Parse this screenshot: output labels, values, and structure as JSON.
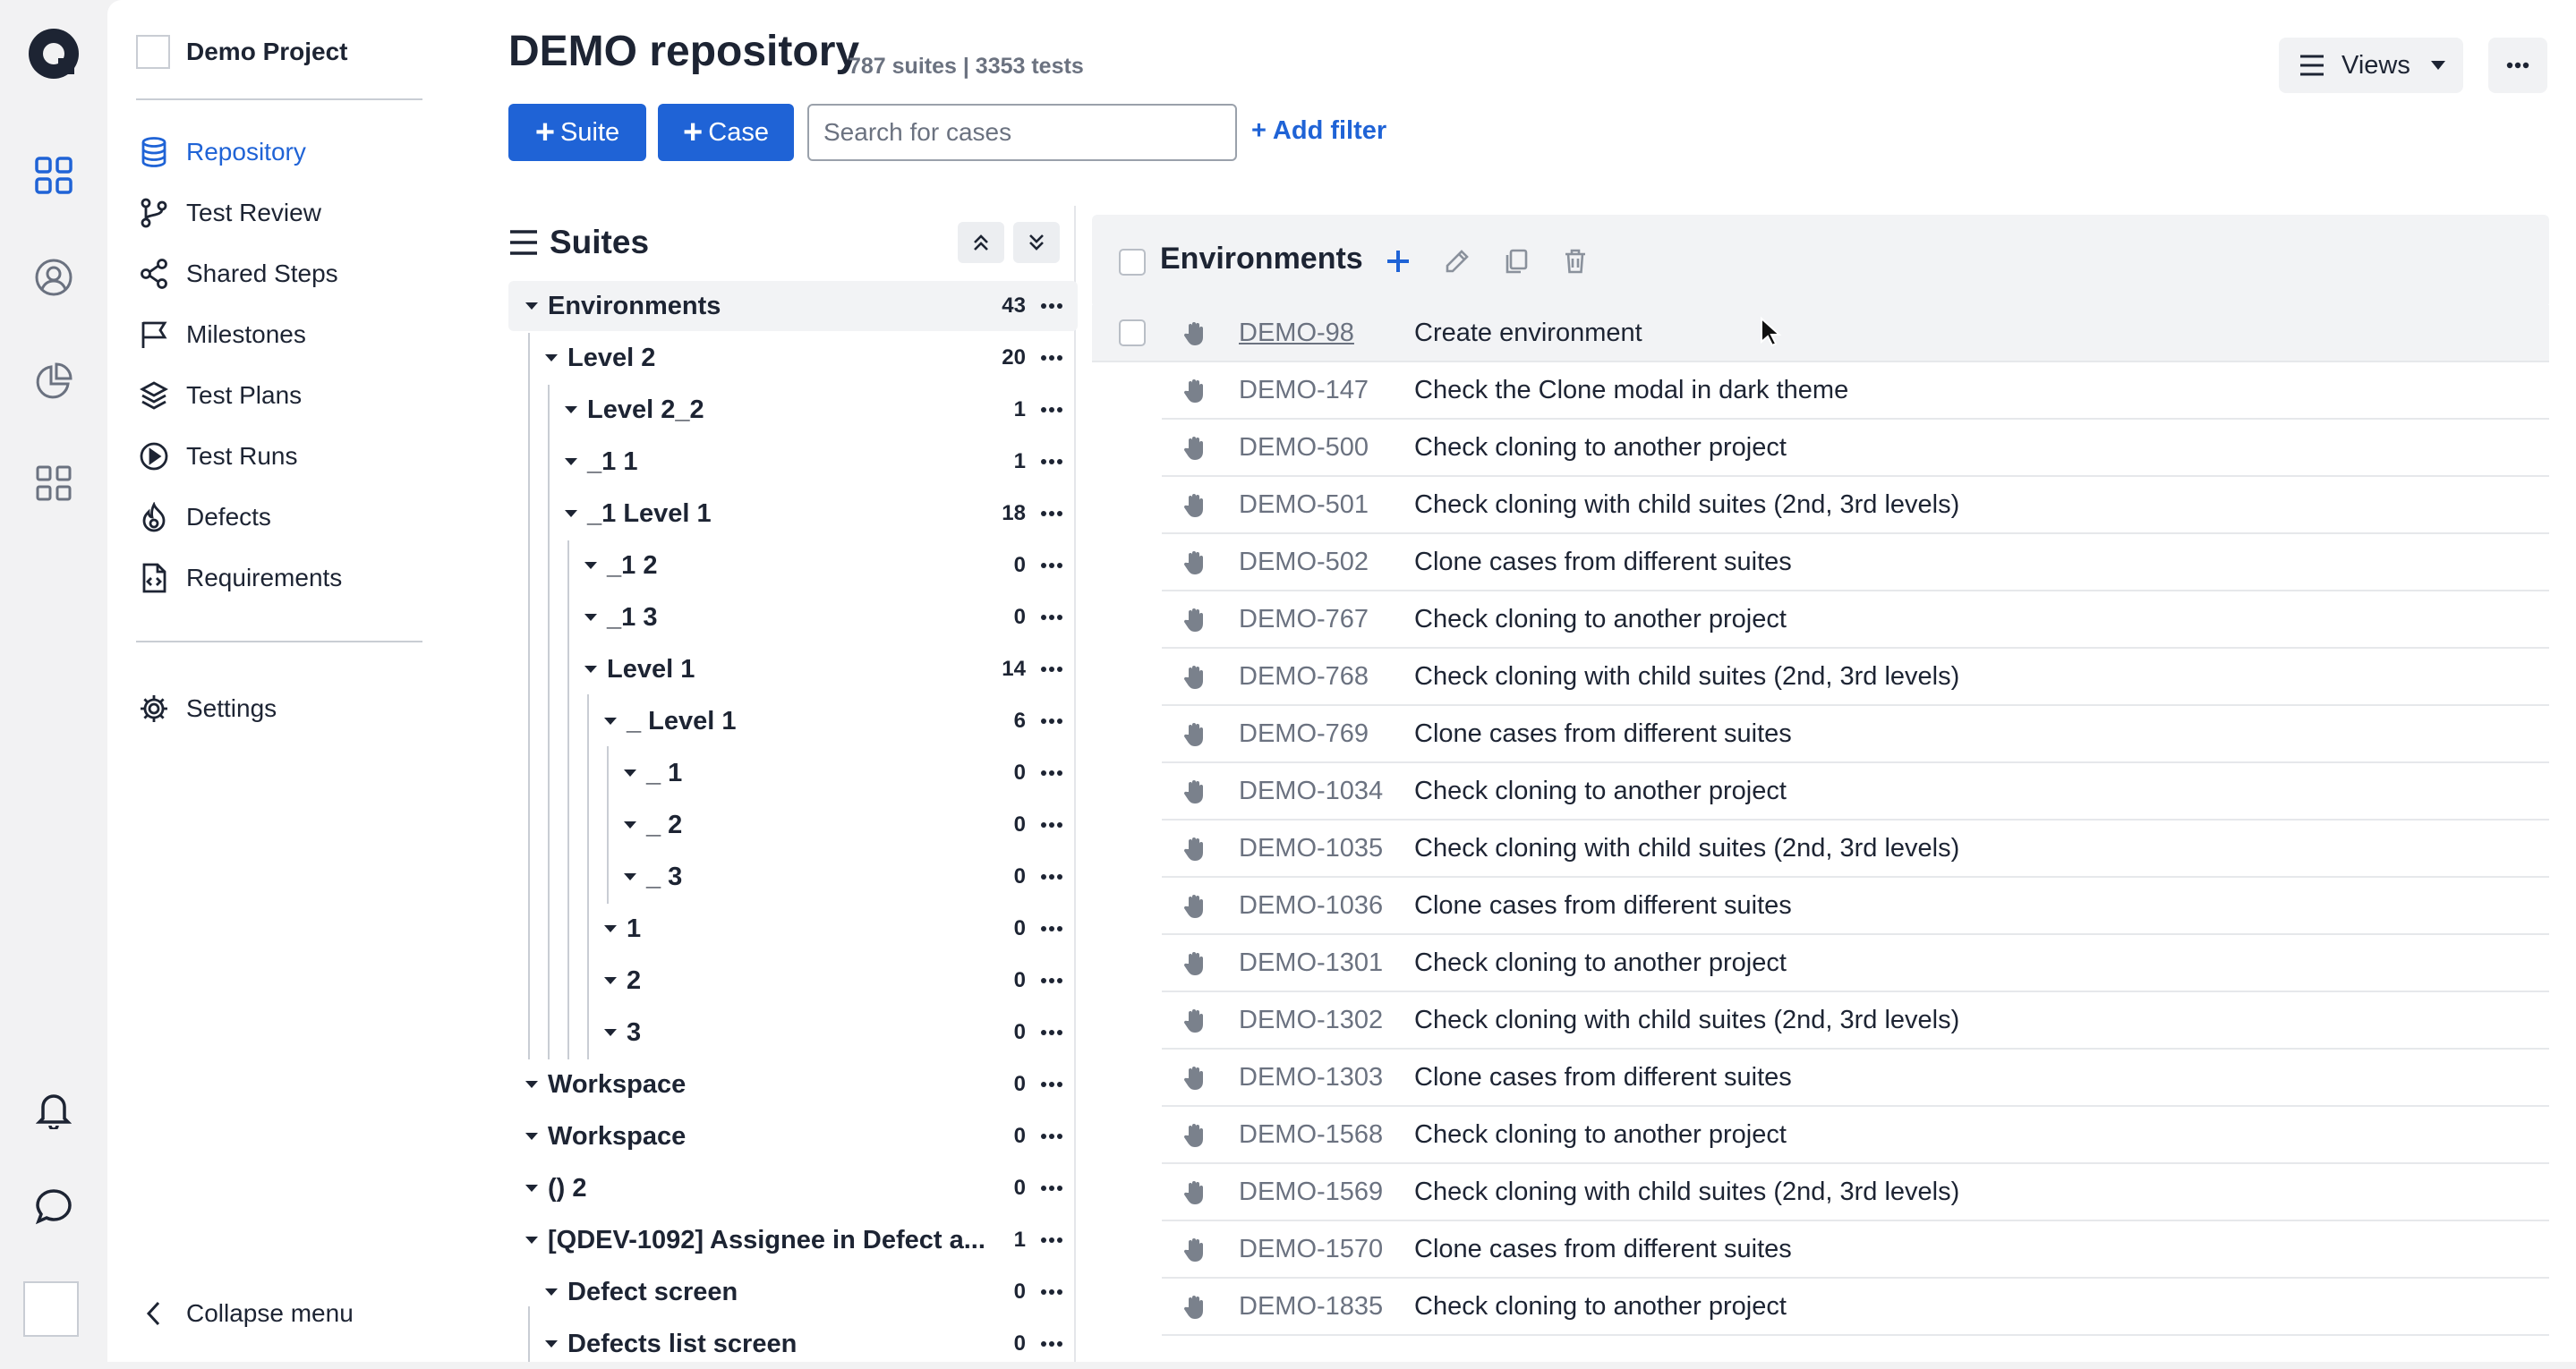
{
  "project": {
    "name": "Demo Project"
  },
  "nav": {
    "items": [
      {
        "label": "Repository",
        "icon": "database-icon",
        "active": true
      },
      {
        "label": "Test Review",
        "icon": "branch-icon"
      },
      {
        "label": "Shared Steps",
        "icon": "share-icon"
      },
      {
        "label": "Milestones",
        "icon": "flag-icon"
      },
      {
        "label": "Test Plans",
        "icon": "layers-icon"
      },
      {
        "label": "Test Runs",
        "icon": "play-circle-icon"
      },
      {
        "label": "Defects",
        "icon": "flame-icon"
      },
      {
        "label": "Requirements",
        "icon": "file-code-icon"
      }
    ],
    "settings": "Settings",
    "collapse": "Collapse menu"
  },
  "header": {
    "title": "DEMO repository",
    "counts": "787 suites | 3353 tests",
    "suite_btn": "Suite",
    "case_btn": "Case",
    "search_placeholder": "Search for cases",
    "add_filter": "+ Add filter",
    "views": "Views"
  },
  "suites": {
    "title": "Suites",
    "rows": [
      {
        "label": "Environments",
        "count": "43"
      },
      {
        "label": "Level 2",
        "count": "20"
      },
      {
        "label": "Level 2_2",
        "count": "1"
      },
      {
        "label": "_1 1",
        "count": "1"
      },
      {
        "label": "_1 Level 1",
        "count": "18"
      },
      {
        "label": "_1 2",
        "count": "0"
      },
      {
        "label": "_1 3",
        "count": "0"
      },
      {
        "label": "Level 1",
        "count": "14"
      },
      {
        "label": "_ Level 1",
        "count": "6"
      },
      {
        "label": "_ 1",
        "count": "0"
      },
      {
        "label": "_ 2",
        "count": "0"
      },
      {
        "label": "_ 3",
        "count": "0"
      },
      {
        "label": "1",
        "count": "0"
      },
      {
        "label": "2",
        "count": "0"
      },
      {
        "label": "3",
        "count": "0"
      },
      {
        "label": "Workspace",
        "count": "0"
      },
      {
        "label": "Workspace",
        "count": "0"
      },
      {
        "label": "() 2",
        "count": "0"
      },
      {
        "label": "[QDEV-1092] Assignee in Defect a...",
        "count": "1"
      },
      {
        "label": "Defect screen",
        "count": "0"
      },
      {
        "label": "Defects list screen",
        "count": "0"
      }
    ]
  },
  "cases": {
    "suite_title": "Environments",
    "rows": [
      {
        "id": "DEMO-98",
        "title": "Create environment"
      },
      {
        "id": "DEMO-147",
        "title": "Check the Clone modal in dark theme"
      },
      {
        "id": "DEMO-500",
        "title": "Check cloning to another project"
      },
      {
        "id": "DEMO-501",
        "title": "Check cloning with child suites (2nd, 3rd levels)"
      },
      {
        "id": "DEMO-502",
        "title": "Clone cases from different suites"
      },
      {
        "id": "DEMO-767",
        "title": "Check cloning to another project"
      },
      {
        "id": "DEMO-768",
        "title": "Check cloning with child suites (2nd, 3rd levels)"
      },
      {
        "id": "DEMO-769",
        "title": "Clone cases from different suites"
      },
      {
        "id": "DEMO-1034",
        "title": "Check cloning to another project"
      },
      {
        "id": "DEMO-1035",
        "title": "Check cloning with child suites (2nd, 3rd levels)"
      },
      {
        "id": "DEMO-1036",
        "title": "Clone cases from different suites"
      },
      {
        "id": "DEMO-1301",
        "title": "Check cloning to another project"
      },
      {
        "id": "DEMO-1302",
        "title": "Check cloning with child suites (2nd, 3rd levels)"
      },
      {
        "id": "DEMO-1303",
        "title": "Clone cases from different suites"
      },
      {
        "id": "DEMO-1568",
        "title": "Check cloning to another project"
      },
      {
        "id": "DEMO-1569",
        "title": "Check cloning with child suites (2nd, 3rd levels)"
      },
      {
        "id": "DEMO-1570",
        "title": "Clone cases from different suites"
      },
      {
        "id": "DEMO-1835",
        "title": "Check cloning to another project"
      }
    ]
  },
  "colors": {
    "accent": "#1f63d6",
    "text": "#1d2433",
    "muted": "#6b7280",
    "rail_bg": "#f2f2f3"
  }
}
